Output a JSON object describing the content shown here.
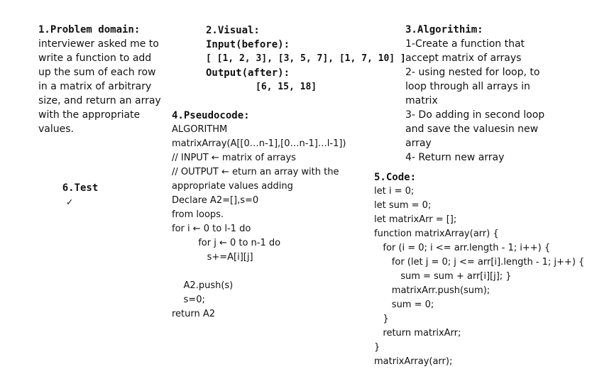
{
  "problem_domain": {
    "heading": "1.Problem domain:",
    "lines": [
      "interviewer asked me to",
      "write a function to add",
      "up the sum of each row",
      "in a matrix of arbitrary",
      "size, and return an array",
      "with the appropriate",
      "values."
    ]
  },
  "test": {
    "heading": "6.Test",
    "check": "✓"
  },
  "visual": {
    "heading": "2.Visual:",
    "input_label": "Input(before):",
    "input_value": "[ [1, 2, 3], [3, 5, 7], [1, 7, 10] ]",
    "output_label": "Output(after):",
    "output_value": "[6, 15, 18]"
  },
  "algorithm": {
    "heading": "3.Algorithim:",
    "lines": [
      "1-Create a function that",
      "accept matrix of arrays",
      "2- using nested for loop, to",
      "loop through all arrays in",
      "matrix",
      "3- Do adding in second loop",
      "and save the valuesin new",
      "array",
      "4- Return new array"
    ]
  },
  "pseudocode": {
    "heading": "4.Pseudocode:",
    "lines": [
      "ALGORITHM",
      "matrixArray(A[[0…n-1],[0…n-1]…l-1])",
      "// INPUT ← matrix of arrays",
      "// OUTPUT ← eturn an array with the",
      "appropriate values adding",
      "Declare A2=[],s=0",
      "from loops.",
      "for i ← 0 to l-1 do",
      "         for j ← 0 to n-1 do",
      "            s+=A[i][j]",
      "",
      "    A2.push(s)",
      "    s=0;",
      "return A2"
    ]
  },
  "code": {
    "heading": "5.Code:",
    "lines": [
      "let i = 0;",
      "let sum = 0;",
      "let matrixArr = [];",
      "function matrixArray(arr) {",
      "   for (i = 0; i <= arr.length - 1; i++) {",
      "      for (let j = 0; j <= arr[i].length - 1; j++) {",
      "         sum = sum + arr[i][j]; }",
      "      matrixArr.push(sum);",
      "      sum = 0;",
      "   }",
      "   return matrixArr;",
      "}",
      "matrixArray(arr);"
    ]
  }
}
